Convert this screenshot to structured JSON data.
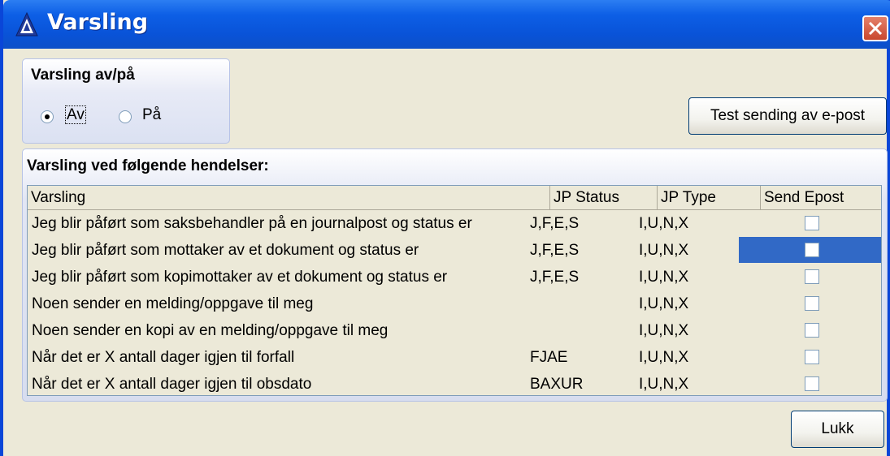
{
  "window": {
    "title": "Varsling",
    "close_label": "close"
  },
  "toggle_group": {
    "title": "Varsling av/på",
    "options": [
      "Av",
      "På"
    ],
    "selected": "Av"
  },
  "test_button": {
    "label": "Test sending av e-post"
  },
  "events_group": {
    "title": "Varsling ved følgende hendelser:",
    "columns": [
      "Varsling",
      "JP Status",
      "JP Type",
      "Send Epost"
    ],
    "rows": [
      {
        "varsling": "Jeg blir påført som saksbehandler på en journalpost og status er",
        "jp_status": "J,F,E,S",
        "jp_type": "I,U,N,X",
        "send_epost": false
      },
      {
        "varsling": "Jeg blir påført som mottaker av et dokument og status er",
        "jp_status": "J,F,E,S",
        "jp_type": "I,U,N,X",
        "send_epost": false,
        "selected": true
      },
      {
        "varsling": "Jeg blir påført som kopimottaker av et dokument og status er",
        "jp_status": "J,F,E,S",
        "jp_type": "I,U,N,X",
        "send_epost": false
      },
      {
        "varsling": "Noen sender en melding/oppgave til meg",
        "jp_status": "",
        "jp_type": "I,U,N,X",
        "send_epost": false
      },
      {
        "varsling": "Noen sender en kopi av en melding/oppgave til meg",
        "jp_status": "",
        "jp_type": "I,U,N,X",
        "send_epost": false
      },
      {
        "varsling": "Når det er X antall dager igjen til forfall",
        "jp_status": "FJAE",
        "jp_type": "I,U,N,X",
        "send_epost": false
      },
      {
        "varsling": "Når det er X antall dager igjen til obsdato",
        "jp_status": "BAXUR",
        "jp_type": "I,U,N,X",
        "send_epost": false
      }
    ]
  },
  "close_button": {
    "label": "Lukk"
  },
  "colors": {
    "titlebar": "#0953d8",
    "selection": "#3169c6",
    "face": "#ece9d8"
  }
}
